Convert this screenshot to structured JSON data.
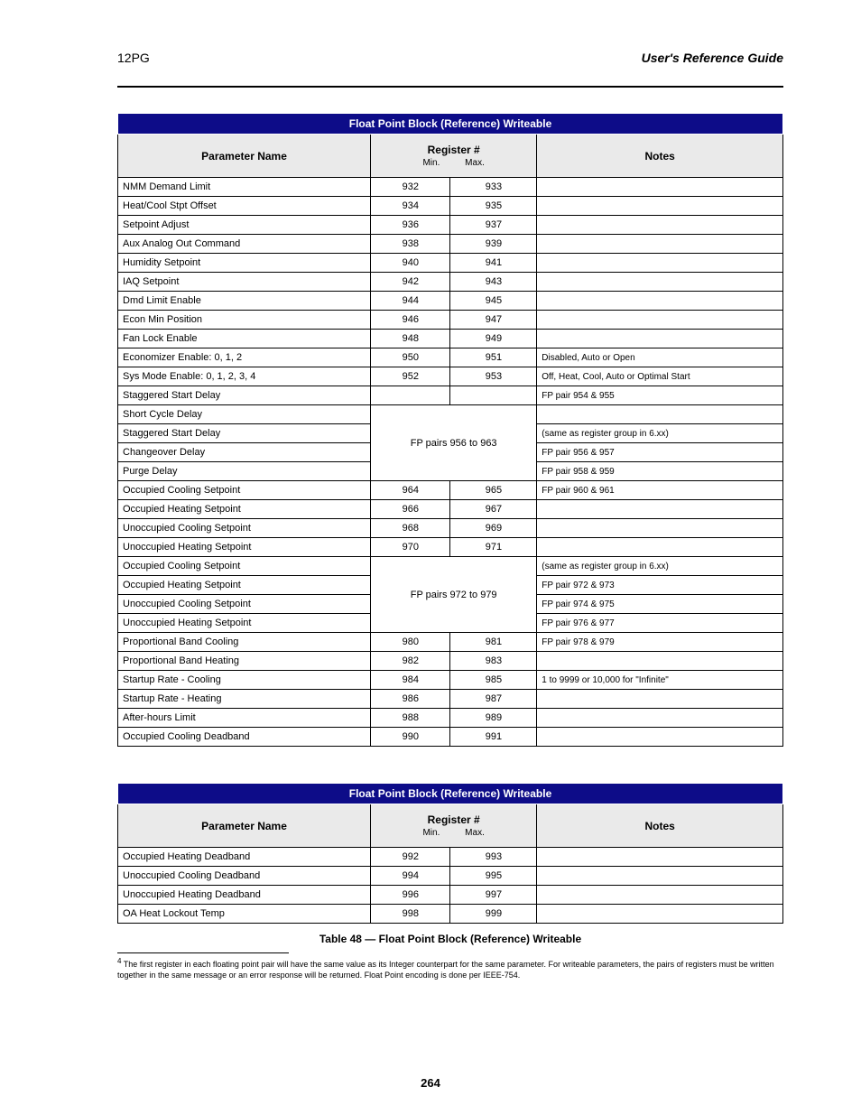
{
  "header": {
    "left": "12PG",
    "right": "User's Reference Guide"
  },
  "tableA": {
    "title": "Float Point Block (Reference) Writeable",
    "columns": {
      "name": "Parameter Name",
      "minmax": "Register #",
      "min": "Min.",
      "max": "Max.",
      "notes": "Notes"
    },
    "rows": [
      {
        "name": "NMM Demand Limit",
        "min": "932",
        "max": "933",
        "notes": ""
      },
      {
        "name": "Heat/Cool Stpt Offset",
        "min": "934",
        "max": "935",
        "notes": ""
      },
      {
        "name": "Setpoint Adjust",
        "min": "936",
        "max": "937",
        "notes": ""
      },
      {
        "name": "Aux Analog Out Command",
        "min": "938",
        "max": "939",
        "notes": ""
      },
      {
        "name": "Humidity Setpoint",
        "min": "940",
        "max": "941",
        "notes": ""
      },
      {
        "name": "IAQ Setpoint",
        "min": "942",
        "max": "943",
        "notes": ""
      },
      {
        "name": "Dmd Limit Enable",
        "min": "944",
        "max": "945",
        "notes": ""
      },
      {
        "name": "Econ Min Position",
        "min": "946",
        "max": "947",
        "notes": ""
      },
      {
        "name": "Fan Lock Enable",
        "min": "948",
        "max": "949",
        "notes": "",
        "noteRowspan": 10,
        "notesMerged": ""
      },
      {
        "name": "Economizer Enable: 0, 1, 2",
        "min": "950",
        "max": "951",
        "notes": "Disabled, Auto or Open"
      },
      {
        "name": "Sys Mode Enable: 0, 1, 2, 3, 4",
        "min": "952",
        "max": "953",
        "notes": "Off, Heat, Cool, Auto or Optimal Start"
      },
      {
        "name": "Staggered Start Delay",
        "min": "",
        "max": "",
        "notes": "FP pair 954 & 955"
      },
      {
        "name": "Short Cycle Delay",
        "min": "",
        "max": "",
        "notesSpan": "FP pairs 956 to 963",
        "notes": "",
        "mergeMinMax": true,
        "mergeRows": 4,
        "emitNote": true
      },
      {
        "name": "Staggered Start Delay",
        "min": "",
        "max": "",
        "notes": "(same as register group in 6.xx)"
      },
      {
        "name": "Changeover Delay",
        "min": "",
        "max": "",
        "notes": "FP pair 956 & 957"
      },
      {
        "name": "Purge Delay",
        "min": "",
        "max": "",
        "notes": "FP pair 958 & 959"
      },
      {
        "name": "Occupied Cooling Setpoint",
        "min": "964",
        "max": "965",
        "notes": "FP pair 960 & 961"
      },
      {
        "name": "Occupied Heating Setpoint",
        "min": "966",
        "max": "967",
        "notes": ""
      },
      {
        "name": "Unoccupied Cooling Setpoint",
        "min": "968",
        "max": "969",
        "notes": ""
      },
      {
        "name": "Unoccupied Heating Setpoint",
        "min": "970",
        "max": "971",
        "notes": ""
      },
      {
        "name": "Occupied Cooling Setpoint",
        "min": "",
        "max": "",
        "notesSpan": "FP pairs 972 to 979",
        "notes": "",
        "mergeMinMax": true,
        "mergeRows": 4,
        "emitNote": "(same as register group in 6.xx)"
      },
      {
        "name": "Occupied Heating Setpoint",
        "min": "",
        "max": "",
        "notes": "FP pair 972 & 973"
      },
      {
        "name": "Unoccupied Cooling Setpoint",
        "min": "",
        "max": "",
        "notes": "FP pair 974 & 975"
      },
      {
        "name": "Unoccupied Heating Setpoint",
        "min": "",
        "max": "",
        "notes": "FP pair 976 & 977"
      },
      {
        "name": "Proportional Band Cooling",
        "min": "980",
        "max": "981",
        "notes": "FP pair 978 & 979"
      },
      {
        "name": "Proportional Band Heating",
        "min": "982",
        "max": "983",
        "notes": ""
      },
      {
        "name": "Startup Rate - Cooling",
        "min": "984",
        "max": "985",
        "notes": "1 to 9999 or 10,000 for \"Infinite\""
      },
      {
        "name": "Startup Rate - Heating",
        "min": "986",
        "max": "987",
        "notes": ""
      },
      {
        "name": "After-hours Limit",
        "min": "988",
        "max": "989",
        "notes": ""
      },
      {
        "name": "Occupied Cooling Deadband",
        "min": "990",
        "max": "991",
        "notes": ""
      }
    ]
  },
  "tableB": {
    "title": "Float Point Block (Reference) Writeable",
    "columns": {
      "name": "Parameter Name",
      "minmax": "Register #",
      "min": "Min.",
      "max": "Max.",
      "notes": "Notes"
    },
    "rows": [
      {
        "name": "Occupied Heating Deadband",
        "min": "992",
        "max": "993",
        "notes": ""
      },
      {
        "name": "Unoccupied Cooling Deadband",
        "min": "994",
        "max": "995",
        "notes": ""
      },
      {
        "name": "Unoccupied Heating Deadband",
        "min": "996",
        "max": "997",
        "notes": ""
      },
      {
        "name": "OA Heat Lockout Temp",
        "min": "998",
        "max": "999",
        "notes": ""
      }
    ],
    "caption": "Table 48 — Float Point Block (Reference) Writeable"
  },
  "footnote": {
    "marker": "4",
    "text": " The first register in each floating point pair will have the same value as its Integer counterpart for the same parameter. For writeable parameters, the pairs of registers must be written together in the same message or an error response will be returned. Float Point encoding is done per IEEE-754."
  },
  "pageNumber": "264"
}
